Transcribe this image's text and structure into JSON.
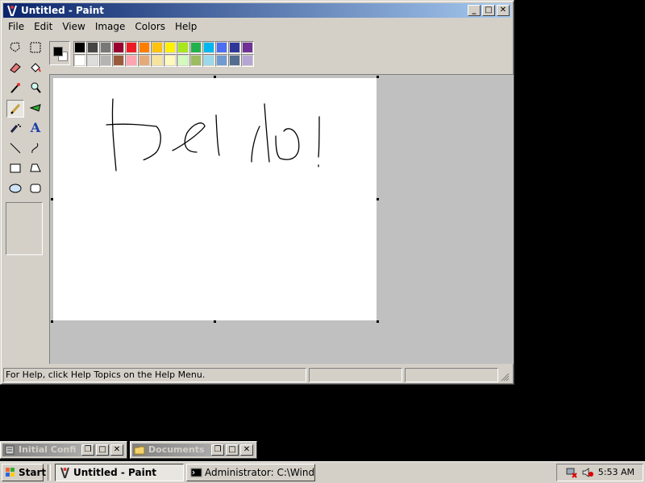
{
  "window": {
    "title": "Untitled - Paint",
    "controls": [
      "minimize",
      "maximize",
      "close"
    ]
  },
  "menu": [
    "File",
    "Edit",
    "View",
    "Image",
    "Colors",
    "Help"
  ],
  "tools": [
    {
      "name": "free-form-select",
      "icon": "☆"
    },
    {
      "name": "select",
      "icon": "⬚"
    },
    {
      "name": "eraser",
      "icon": "▭"
    },
    {
      "name": "fill",
      "icon": "◇"
    },
    {
      "name": "pick-color",
      "icon": "╱"
    },
    {
      "name": "magnifier",
      "icon": "⚲"
    },
    {
      "name": "pencil",
      "icon": "✎",
      "selected": true
    },
    {
      "name": "brush",
      "icon": "⌇"
    },
    {
      "name": "airbrush",
      "icon": "✦"
    },
    {
      "name": "text",
      "icon": "A"
    },
    {
      "name": "line",
      "icon": "╲"
    },
    {
      "name": "curve",
      "icon": "∫"
    },
    {
      "name": "rectangle",
      "icon": "□"
    },
    {
      "name": "polygon",
      "icon": "⬠"
    },
    {
      "name": "ellipse",
      "icon": "○"
    },
    {
      "name": "rounded-rectangle",
      "icon": "▢"
    }
  ],
  "colors": {
    "foreground": "#000000",
    "background": "#ffffff",
    "palette_row1": [
      "#000000",
      "#464646",
      "#787878",
      "#990030",
      "#ed1c24",
      "#ff7e00",
      "#ffc20e",
      "#fff200",
      "#a8e61d",
      "#22b14c",
      "#00b7ef",
      "#4d6df3",
      "#2f3699",
      "#6f3198"
    ],
    "palette_row2": [
      "#ffffff",
      "#dcdcdc",
      "#b4b4b4",
      "#9c5a3c",
      "#ffa3b1",
      "#e5aa7a",
      "#f5e49c",
      "#fff9bd",
      "#d3f9bc",
      "#9dbb61",
      "#99d9ea",
      "#709ad1",
      "#546d8e",
      "#b5a5d5"
    ]
  },
  "canvas": {
    "drawing_strokes": "handwritten text",
    "text": "bel lo!"
  },
  "statusbar": {
    "help_text": "For Help, click Help Topics on the Help Menu.",
    "cell2": "",
    "cell3": ""
  },
  "minimized_windows": [
    {
      "title": "Initial Config...",
      "icon": "config-icon"
    },
    {
      "title": "Documents",
      "icon": "folder-icon"
    }
  ],
  "taskbar": {
    "start_label": "Start",
    "buttons": [
      {
        "label": "Untitled - Paint",
        "active": true,
        "icon": "paint-icon"
      },
      {
        "label": "Administrator: C:\\Windo...",
        "active": false,
        "icon": "cmd-icon"
      }
    ],
    "clock": "5:53 AM"
  }
}
